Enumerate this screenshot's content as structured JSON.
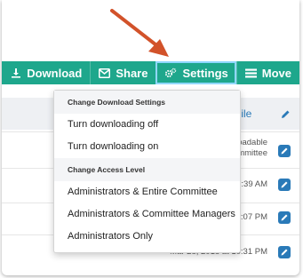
{
  "toolbar": {
    "download_label": "Download",
    "share_label": "Share",
    "settings_label": "Settings",
    "move_label": "Move",
    "color": "#1ea78c"
  },
  "subbar": {
    "link_text": "l File"
  },
  "rows": [
    {
      "text_line1": "oadable",
      "text_line2": "mmittee"
    },
    {
      "text_line1": ":39 AM"
    },
    {
      "text_line1": "5:07 PM"
    },
    {
      "text_line1": "Mar 28, 2018 at 10:31 PM"
    }
  ],
  "dropdown": {
    "download_header": "Change Download Settings",
    "download_items": [
      "Turn downloading off",
      "Turn downloading on"
    ],
    "access_header": "Change Access Level",
    "access_items": [
      "Administrators & Entire Committee",
      "Administrators & Committee Managers",
      "Administrators Only"
    ]
  },
  "accent_colors": {
    "arrow": "#d2522a",
    "link": "#2a7ab8"
  }
}
